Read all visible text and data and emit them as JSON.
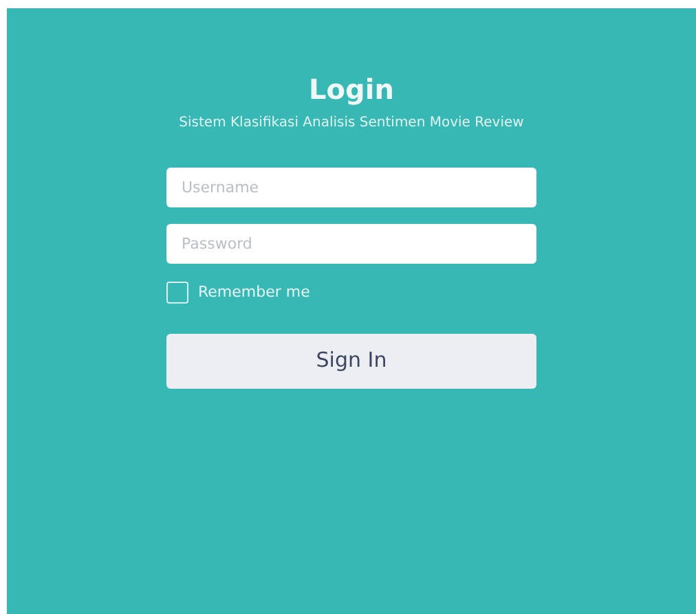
{
  "title": "Login",
  "subtitle": "Sistem Klasifikasi Analisis Sentimen Movie Review",
  "fields": [
    {
      "placeholder": "Username"
    },
    {
      "placeholder": "Password"
    }
  ],
  "remember": {
    "label": "Remember me",
    "checked": false
  },
  "button": "Sign In"
}
